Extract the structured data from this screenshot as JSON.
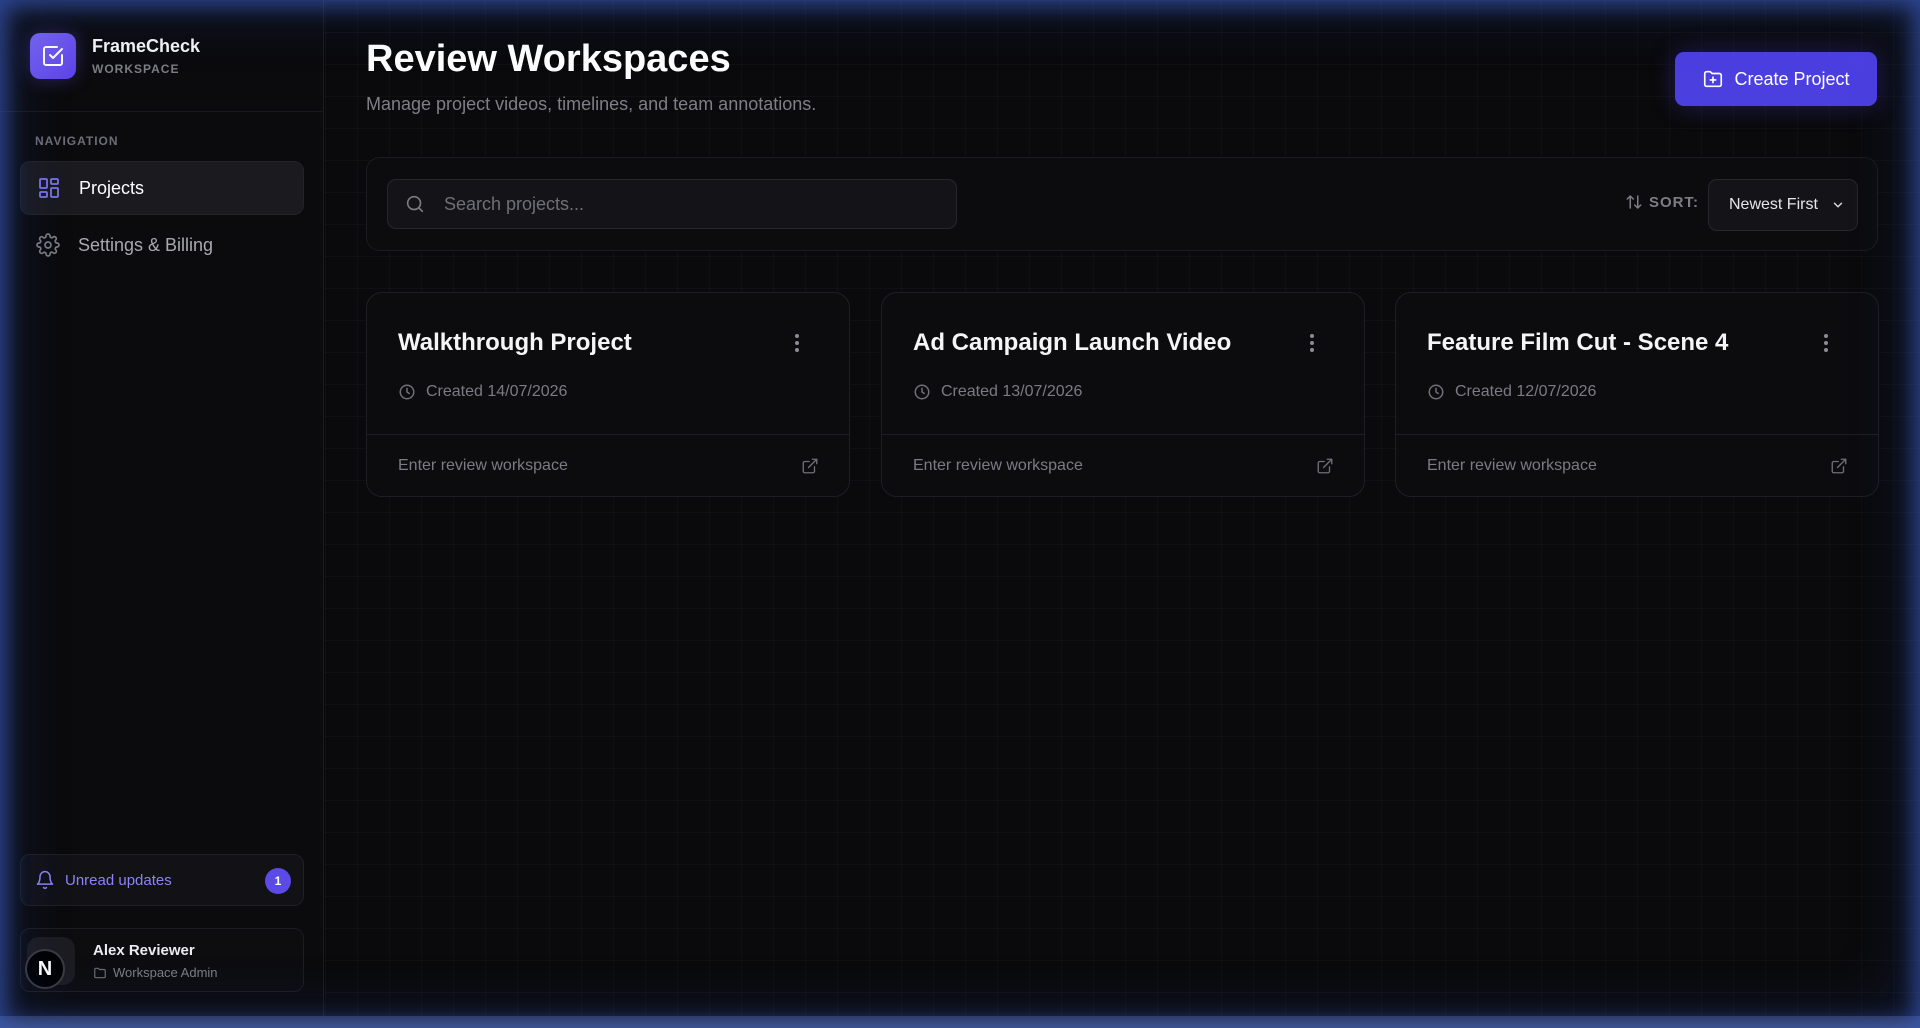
{
  "brand": {
    "name": "FrameCheck",
    "subtitle": "WORKSPACE"
  },
  "sidebar": {
    "heading": "NAVIGATION",
    "items": [
      {
        "label": "Projects",
        "icon": "grid-icon",
        "active": true
      },
      {
        "label": "Settings & Billing",
        "icon": "gear-icon",
        "active": false
      }
    ],
    "notifications": {
      "label": "Unread updates",
      "count": "1"
    },
    "user": {
      "name": "Alex Reviewer",
      "role": "Workspace Admin",
      "avatar_letter": "N"
    }
  },
  "header": {
    "title": "Review Workspaces",
    "subtitle": "Manage project videos, timelines, and team annotations.",
    "create_label": "Create Project"
  },
  "toolbar": {
    "search_placeholder": "Search projects...",
    "sort_label": "SORT:",
    "sort_value": "Newest First"
  },
  "projects": [
    {
      "title": "Walkthrough Project",
      "created": "Created 14/07/2026",
      "link": "Enter review workspace"
    },
    {
      "title": "Ad Campaign Launch Video",
      "created": "Created 13/07/2026",
      "link": "Enter review workspace"
    },
    {
      "title": "Feature Film Cut - Scene 4",
      "created": "Created 12/07/2026",
      "link": "Enter review workspace"
    }
  ],
  "colors": {
    "accent": "#4c3fe0",
    "brand_gradient_start": "#7b66f5",
    "brand_gradient_end": "#5b43e6",
    "notification_text": "#8b84f7",
    "background": "#0a0a0c"
  }
}
